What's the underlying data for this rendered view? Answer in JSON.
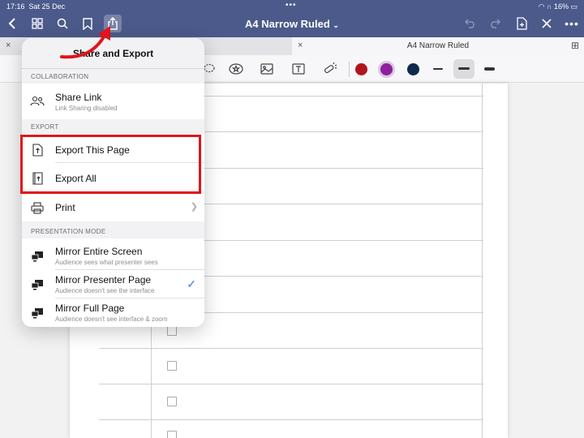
{
  "status": {
    "time": "17:16",
    "date": "Sat 25 Dec",
    "battery": "16%"
  },
  "nav": {
    "title": "A4 Narrow Ruled"
  },
  "tabs": {
    "right_label": "A4 Narrow Ruled"
  },
  "colors": {
    "nav_bg": "#4b5a8a",
    "highlight": "#e1141b",
    "accent": "#2f7cf6",
    "swatch_red": "#b1151b",
    "swatch_purple": "#8e1e9e",
    "swatch_navy": "#0f2a4d"
  },
  "popover": {
    "title": "Share and Export",
    "sections": {
      "collaboration": "COLLABORATION",
      "export": "EXPORT",
      "presentation": "PRESENTATION MODE"
    },
    "share_link": {
      "title": "Share Link",
      "subtitle": "Link Sharing disabled"
    },
    "export_page": {
      "title": "Export This Page"
    },
    "export_all": {
      "title": "Export All"
    },
    "print": {
      "title": "Print"
    },
    "mirror_screen": {
      "title": "Mirror Entire Screen",
      "subtitle": "Audience sees what presenter sees"
    },
    "mirror_presenter": {
      "title": "Mirror Presenter Page",
      "subtitle": "Audience doesn't see the interface",
      "selected": true
    },
    "mirror_full": {
      "title": "Mirror Full Page",
      "subtitle": "Audience doesn't see interface & zoom"
    }
  }
}
